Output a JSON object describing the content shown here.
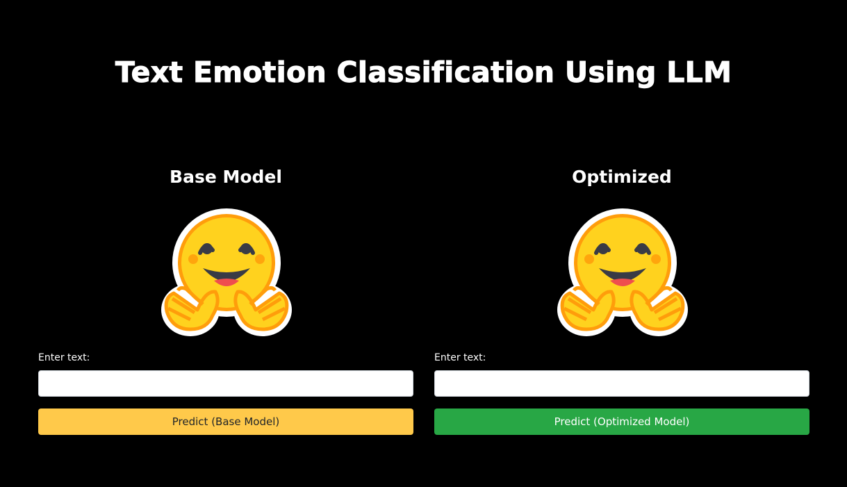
{
  "page": {
    "title": "Text Emotion Classification Using LLM"
  },
  "panels": [
    {
      "heading": "Base Model",
      "icon": "hugging-face-icon",
      "input_label": "Enter text:",
      "input_value": "",
      "button_label": "Predict (Base Model)",
      "button_color": "#ffc94a"
    },
    {
      "heading": "Optimized",
      "icon": "hugging-face-icon",
      "input_label": "Enter text:",
      "input_value": "",
      "button_label": "Predict (Optimized Model)",
      "button_color": "#28a745"
    }
  ],
  "colors": {
    "background": "#000000",
    "emoji_face": "#ffd21e",
    "emoji_outline": "#ff9d0b"
  }
}
